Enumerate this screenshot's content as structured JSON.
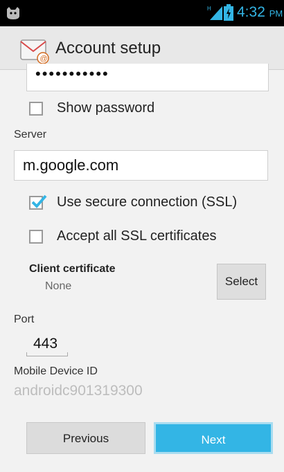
{
  "status_bar": {
    "time": "4:32",
    "ampm": "PM",
    "icons": [
      "android-cat-icon",
      "signal-icon",
      "battery-icon"
    ]
  },
  "action_bar": {
    "title": "Account setup",
    "icon": "email-app-icon"
  },
  "form": {
    "password_masked": "•••••••••••",
    "show_password_label": "Show password",
    "show_password_checked": false,
    "server_label": "Server",
    "server_value": "m.google.com",
    "ssl_label": "Use secure connection (SSL)",
    "ssl_checked": true,
    "accept_ssl_label": "Accept all SSL certificates",
    "accept_ssl_checked": false,
    "client_certificate_label": "Client certificate",
    "client_certificate_value": "None",
    "select_label": "Select",
    "port_label": "Port",
    "port_value": "443",
    "device_id_label": "Mobile Device ID",
    "device_id_value": "androidc901319300"
  },
  "buttons": {
    "previous": "Previous",
    "next": "Next"
  },
  "colors": {
    "accent": "#33b5e5",
    "background": "#f2f2f2"
  }
}
